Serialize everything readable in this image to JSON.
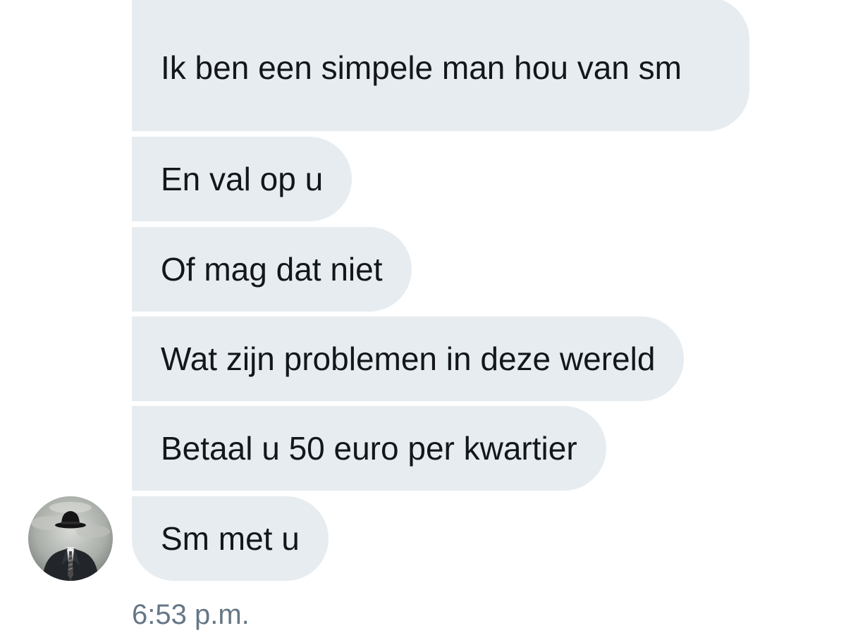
{
  "conversation": {
    "messages": [
      {
        "text": "Ik ben een simpele man hou van sm"
      },
      {
        "text": "En val op u"
      },
      {
        "text": "Of mag dat niet"
      },
      {
        "text": "Wat zijn problemen in deze wereld"
      },
      {
        "text": "Betaal u 50 euro per kwartier"
      },
      {
        "text": "Sm met u"
      }
    ],
    "timestamp": "6:53 p.m.",
    "avatar_icon": "man-in-bowler-hat-avatar"
  },
  "colors": {
    "bubble_background": "#e6ecf0",
    "text": "#14171a",
    "timestamp": "#657786"
  }
}
